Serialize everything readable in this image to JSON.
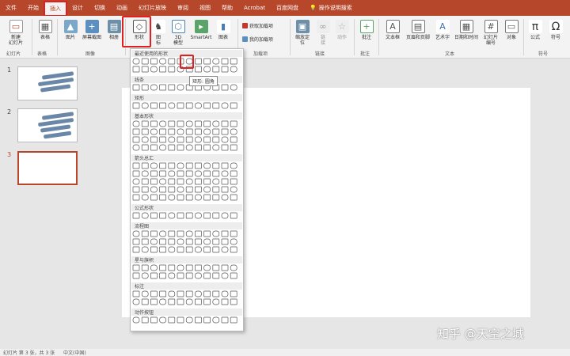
{
  "menu": {
    "tabs": [
      "文件",
      "开始",
      "插入",
      "设计",
      "切换",
      "动画",
      "幻灯片放映",
      "审阅",
      "视图",
      "帮助",
      "Acrobat",
      "百度网盘"
    ],
    "active_tab": "插入",
    "tell_me": "操作说明搜索"
  },
  "ribbon": {
    "slides": {
      "new_slide": "新建\n幻灯片",
      "group": "幻灯片"
    },
    "tables": {
      "table": "表格",
      "group": "表格"
    },
    "images": {
      "picture": "图片",
      "screenshot": "屏幕截图",
      "album": "相册",
      "group": "图像"
    },
    "illustrations": {
      "shapes": "形状",
      "icons": "图\n标",
      "model3d": "3D\n模型",
      "smartart": "SmartArt",
      "chart": "图表"
    },
    "addins": {
      "get": "获取加载项",
      "mine": "我的加载项",
      "group": "加载项"
    },
    "links": {
      "zoom": "缩放定\n位",
      "link": "链\n接",
      "action": "动作",
      "group": "链接"
    },
    "comments": {
      "comment": "批注",
      "group": "批注"
    },
    "text": {
      "textbox": "文本框",
      "header_footer": "页眉和页脚",
      "wordart": "艺术字",
      "datetime": "日期和时间",
      "slide_number": "幻灯片\n编号",
      "object": "对象",
      "group": "文本"
    },
    "symbols": {
      "equation": "公式",
      "symbol": "符号",
      "group": "符号"
    }
  },
  "accent_color": "#b7472a",
  "highlight_color": "#e02020",
  "shapes_panel": {
    "sections": [
      "最近使用的形状",
      "线条",
      "矩形",
      "基本形状",
      "箭头总汇",
      "公式形状",
      "流程图",
      "星与旗帜",
      "标注",
      "动作按钮"
    ],
    "tooltip": "矩形: 圆角"
  },
  "slides": [
    {
      "number": "1"
    },
    {
      "number": "2"
    },
    {
      "number": "3"
    }
  ],
  "status": {
    "slide_info": "幻灯片 第 3 张，共 3 张",
    "language": "中文(中国)"
  },
  "watermark": "知乎 @天空之城"
}
